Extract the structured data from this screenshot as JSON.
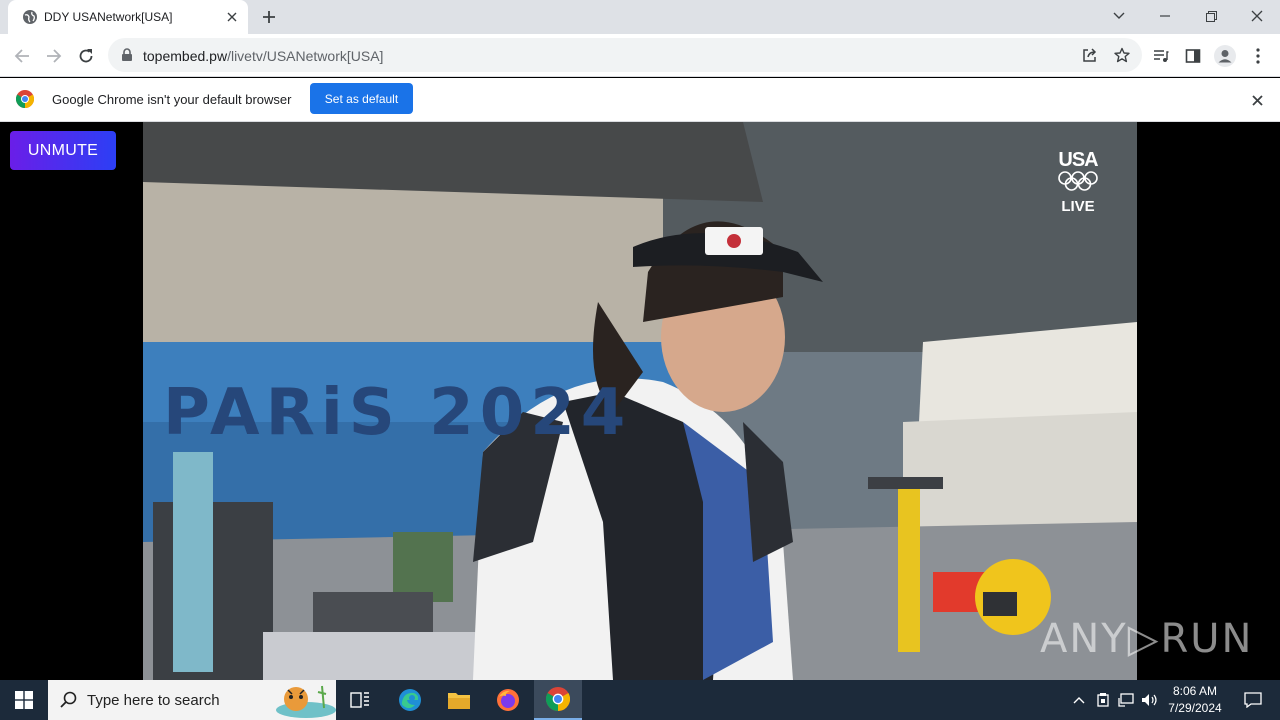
{
  "browser": {
    "tab_title": "DDY USANetwork[USA]",
    "url_host": "topembed.pw",
    "url_path": "/livetv/USANetwork[USA]"
  },
  "infobar": {
    "message": "Google Chrome isn't your default browser",
    "button_label": "Set as default"
  },
  "page": {
    "unmute_label": "UNMUTE",
    "network_logo_text": "USA",
    "live_badge": "LIVE",
    "watermark": "ANY▷RUN",
    "video_signage_text": "PARiS 2024"
  },
  "taskbar": {
    "search_placeholder": "Type here to search",
    "time": "8:06 AM",
    "date": "7/29/2024"
  },
  "icons": [
    "globe-icon",
    "close-icon",
    "plus-icon",
    "chevron-down-icon",
    "minimize-icon",
    "restore-icon",
    "back-icon",
    "forward-icon",
    "reload-icon",
    "lock-icon",
    "share-icon",
    "star-icon",
    "media-icon",
    "sidepanel-icon",
    "profile-icon",
    "kebab-icon",
    "chrome-icon",
    "windows-icon",
    "search-icon",
    "task-view-icon",
    "edge-icon",
    "file-explorer-icon",
    "firefox-icon",
    "chrome-taskbar-icon",
    "chevron-up-icon",
    "network-icon",
    "volume-icon",
    "notification-icon"
  ],
  "colors": {
    "accent": "#1a73e8",
    "unmute_gradient_start": "#6a1ee8",
    "unmute_gradient_end": "#2c3ff5",
    "taskbar": "#1c2a3a"
  }
}
